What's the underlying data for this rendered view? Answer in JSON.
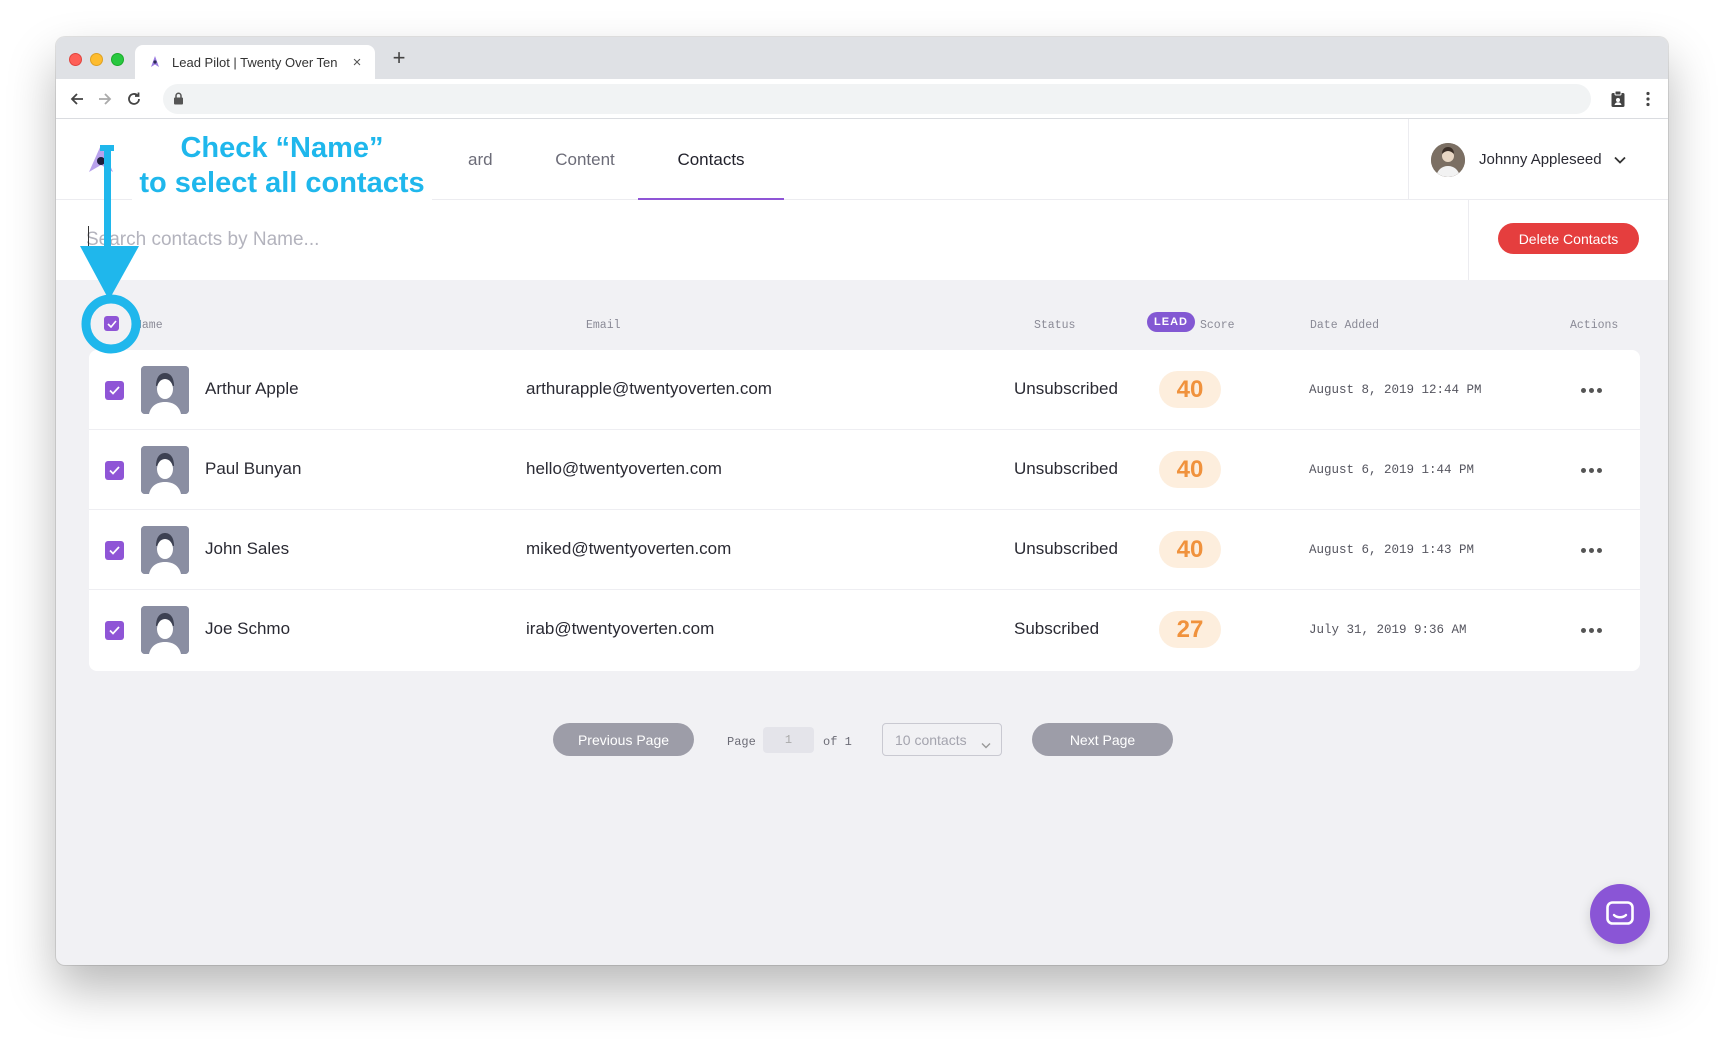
{
  "browser": {
    "tab_title": "Lead Pilot | Twenty Over Ten",
    "new_tab_symbol": "+",
    "close_symbol": "×",
    "url": ""
  },
  "nav": {
    "tabs": [
      {
        "label": "Dashboard",
        "visible_label": "ard"
      },
      {
        "label": "Content"
      },
      {
        "label": "Contacts",
        "active": true
      }
    ]
  },
  "user": {
    "name": "Johnny Appleseed"
  },
  "search": {
    "placeholder": "Search contacts by Name...",
    "value": ""
  },
  "actions": {
    "delete_label": "Delete Contacts"
  },
  "table": {
    "headers": {
      "name": "Name",
      "email": "Email",
      "status": "Status",
      "lead_badge": "LEAD",
      "score": "Score",
      "date": "Date Added",
      "actions": "Actions"
    },
    "select_all_checked": true,
    "rows": [
      {
        "name": "Arthur Apple",
        "email": "arthurapple@twentyoverten.com",
        "status": "Unsubscribed",
        "score": "40",
        "date": "August 8, 2019 12:44 PM",
        "checked": true
      },
      {
        "name": "Paul Bunyan",
        "email": "hello@twentyoverten.com",
        "status": "Unsubscribed",
        "score": "40",
        "date": "August 6, 2019 1:44 PM",
        "checked": true
      },
      {
        "name": "John Sales",
        "email": "miked@twentyoverten.com",
        "status": "Unsubscribed",
        "score": "40",
        "date": "August 6, 2019 1:43 PM",
        "checked": true
      },
      {
        "name": "Joe Schmo",
        "email": "irab@twentyoverten.com",
        "status": "Subscribed",
        "score": "27",
        "date": "July 31, 2019 9:36 AM",
        "checked": true
      }
    ]
  },
  "pagination": {
    "prev_label": "Previous Page",
    "next_label": "Next Page",
    "page_label": "Page",
    "page_value": "1",
    "of_label": "of 1",
    "per_page": "10 contacts"
  },
  "annotation": {
    "line1": "Check “Name”",
    "line2": "to select all contacts",
    "color": "#1fb7ec"
  },
  "colors": {
    "accent": "#8f55d6",
    "danger": "#e53e3e",
    "score_text": "#f0923d",
    "score_bg": "#fdeedd"
  }
}
